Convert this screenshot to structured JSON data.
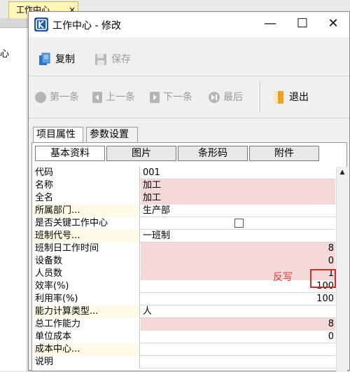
{
  "background": {
    "tab_title": "工作中心",
    "tab_close": "×",
    "side_text": "心"
  },
  "window": {
    "title": "工作中心 - 修改",
    "minimize": "—",
    "maximize": "☐",
    "close": "✕"
  },
  "toolbar1": {
    "copy": "复制",
    "save": "保存"
  },
  "toolbar2": {
    "first": "第一条",
    "prev": "上一条",
    "next": "下一条",
    "last": "最后",
    "exit": "退出"
  },
  "tabs": [
    "项目属性",
    "参数设置"
  ],
  "subtabs": [
    "基本资料",
    "图片",
    "条形码",
    "附件"
  ],
  "rows": [
    {
      "label": "代码",
      "value": ""
    },
    {
      "label": "名称",
      "value": "加工"
    },
    {
      "label": "全名",
      "value": "加工"
    },
    {
      "label": "所属部门...",
      "value": "生产部"
    },
    {
      "label": "是否关键工作中心",
      "value": ""
    },
    {
      "label": "班制代号...",
      "value": "一班制"
    },
    {
      "label": "班制日工作时间",
      "value": "8"
    },
    {
      "label": "设备数",
      "value": "0"
    },
    {
      "label": "人员数",
      "value": "1"
    },
    {
      "label": "效率(%)",
      "value": "100"
    },
    {
      "label": "利用率(%)",
      "value": "100"
    },
    {
      "label": "能力计算类型...",
      "value": "人"
    },
    {
      "label": "总工作能力",
      "value": "8"
    },
    {
      "label": "单位成本",
      "value": "0"
    },
    {
      "label": "成本中心...",
      "value": ""
    },
    {
      "label": "说明",
      "value": ""
    }
  ],
  "code_value": "001",
  "annotation": "反写",
  "colors": {
    "required_field": "#f4d9d9",
    "ref_label": "#fffbe6",
    "annotation_red": "#d72a2a"
  }
}
